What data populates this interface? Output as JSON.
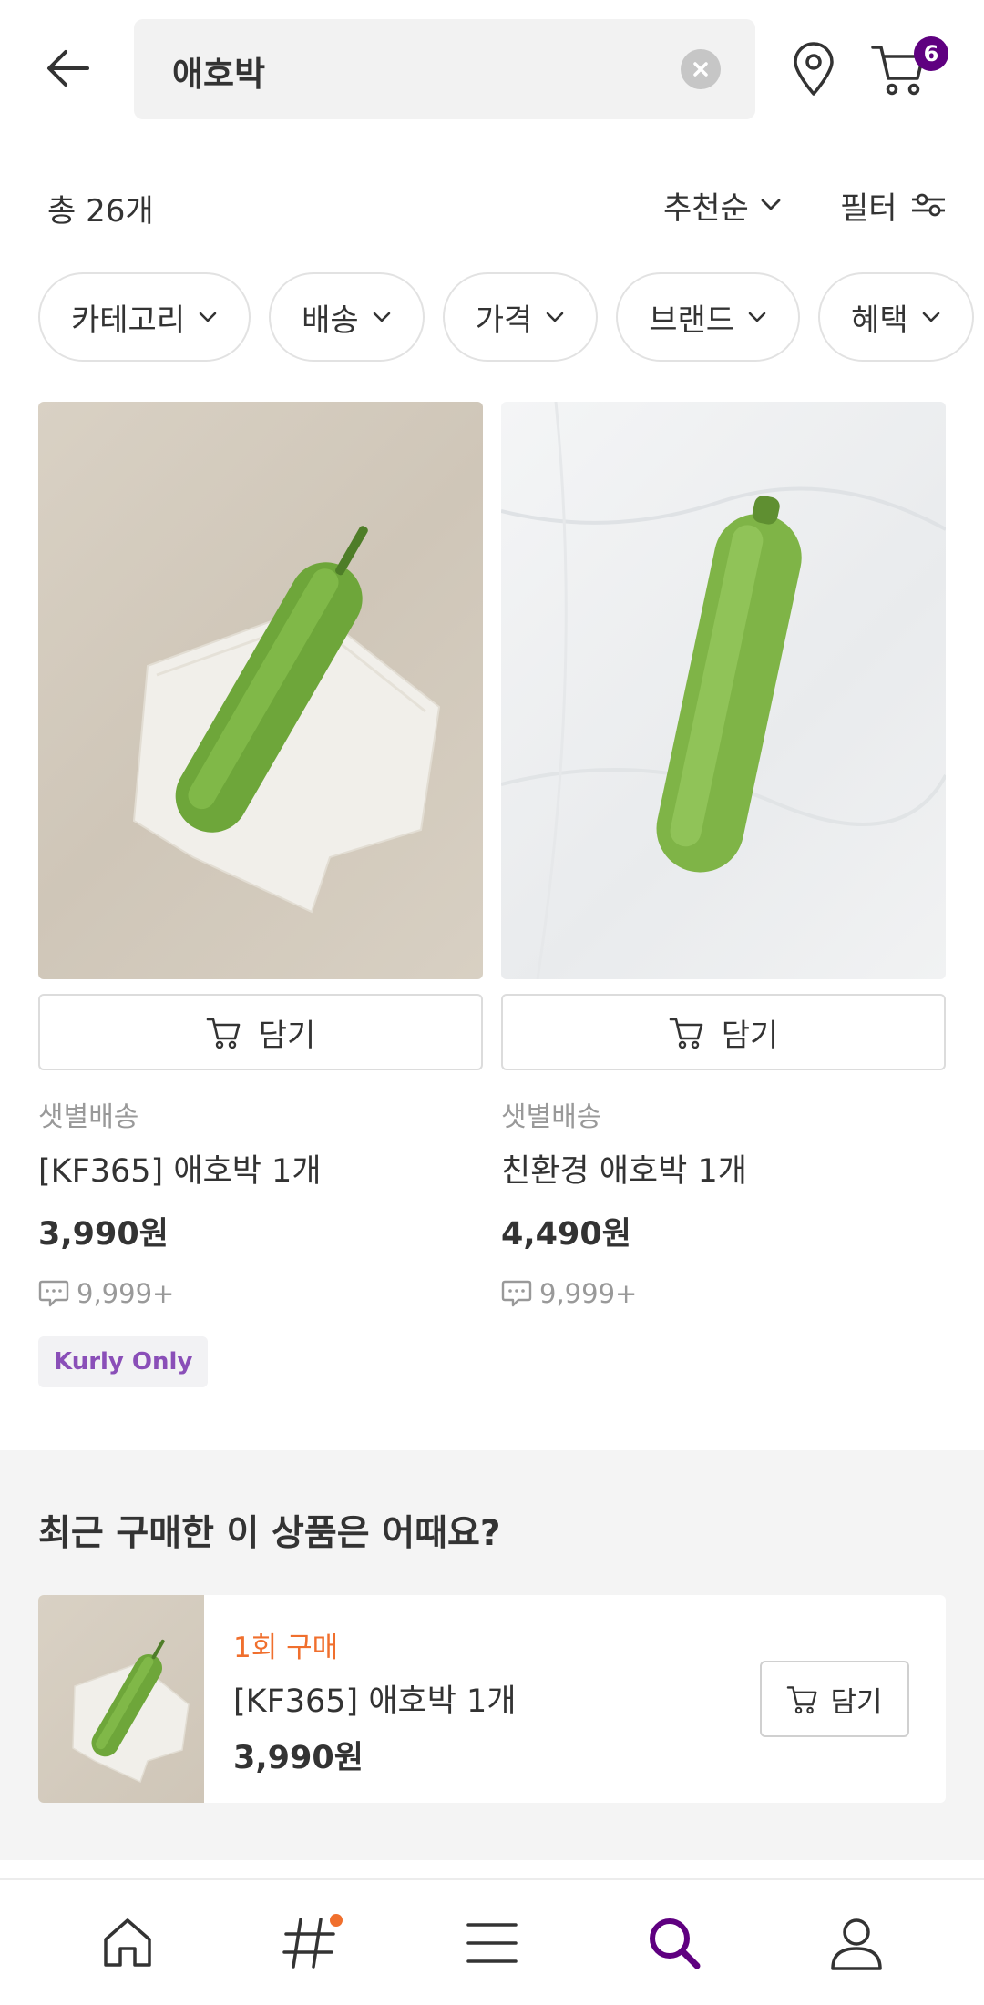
{
  "header": {
    "search_value": "애호박",
    "cart_count": "6"
  },
  "summary": {
    "total_label": "총 26개",
    "sort_label": "추천순",
    "filter_label": "필터"
  },
  "chips": [
    "카테고리",
    "배송",
    "가격",
    "브랜드",
    "혜택"
  ],
  "products": [
    {
      "add_label": "담기",
      "delivery": "샛별배송",
      "name": "[KF365] 애호박 1개",
      "price": "3,990원",
      "reviews": "9,999+",
      "tag": "Kurly Only"
    },
    {
      "add_label": "담기",
      "delivery": "샛별배송",
      "name": "친환경 애호박 1개",
      "price": "4,490원",
      "reviews": "9,999+"
    }
  ],
  "recent": {
    "title": "최근 구매한 이 상품은 어때요?",
    "purchase_count": "1회 구매",
    "name": "[KF365] 애호박 1개",
    "price": "3,990원",
    "add_label": "담기"
  },
  "nav": {
    "items": [
      "home-icon",
      "hashtag-icon",
      "menu-icon",
      "search-icon",
      "user-icon"
    ],
    "active": "search-icon",
    "accent": "#5f0080"
  },
  "colors": {
    "brand": "#5f0080",
    "highlight": "#f06f2d",
    "tag_text": "#8a4fb8"
  }
}
